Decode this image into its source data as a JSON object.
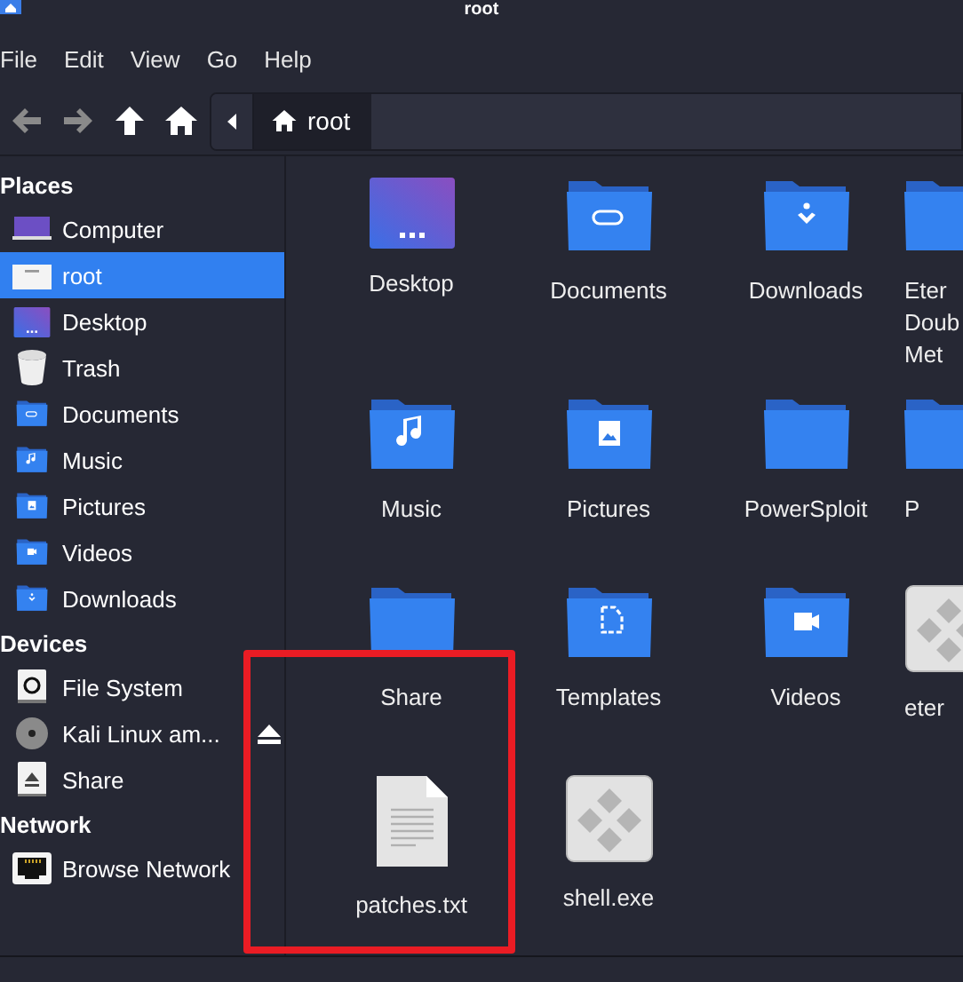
{
  "window": {
    "title": "root"
  },
  "menu": [
    "File",
    "Edit",
    "View",
    "Go",
    "Help"
  ],
  "path": {
    "segment": "root"
  },
  "sidebar": [
    {
      "heading": "Places",
      "items": [
        {
          "label": "Computer",
          "kind": "computer",
          "selected": false
        },
        {
          "label": "root",
          "kind": "home",
          "selected": true
        },
        {
          "label": "Desktop",
          "kind": "desktop",
          "selected": false
        },
        {
          "label": "Trash",
          "kind": "trash",
          "selected": false
        },
        {
          "label": "Documents",
          "kind": "documents",
          "selected": false
        },
        {
          "label": "Music",
          "kind": "music",
          "selected": false
        },
        {
          "label": "Pictures",
          "kind": "pictures",
          "selected": false
        },
        {
          "label": "Videos",
          "kind": "videos",
          "selected": false
        },
        {
          "label": "Downloads",
          "kind": "downloads",
          "selected": false
        }
      ]
    },
    {
      "heading": "Devices",
      "items": [
        {
          "label": "File System",
          "kind": "drive",
          "selected": false
        },
        {
          "label": "Kali Linux am...",
          "kind": "disc",
          "selected": false,
          "ejectable": true
        },
        {
          "label": "Share",
          "kind": "share",
          "selected": false
        }
      ]
    },
    {
      "heading": "Network",
      "items": [
        {
          "label": "Browse Network",
          "kind": "network",
          "selected": false
        }
      ]
    }
  ],
  "files": [
    {
      "lines": [
        "Desktop"
      ],
      "kind": "desktop"
    },
    {
      "lines": [
        "Documents"
      ],
      "kind": "documents"
    },
    {
      "lines": [
        "Downloads"
      ],
      "kind": "downloads"
    },
    {
      "lines": [
        "Eter",
        "Doub",
        "Met"
      ],
      "kind": "folder"
    },
    {
      "lines": [
        "Music"
      ],
      "kind": "music"
    },
    {
      "lines": [
        "Pictures"
      ],
      "kind": "pictures"
    },
    {
      "lines": [
        "PowerSploit"
      ],
      "kind": "folder"
    },
    {
      "lines": [
        "P"
      ],
      "kind": "folder"
    },
    {
      "lines": [
        "Share"
      ],
      "kind": "folder"
    },
    {
      "lines": [
        "Templates"
      ],
      "kind": "templates"
    },
    {
      "lines": [
        "Videos"
      ],
      "kind": "videos"
    },
    {
      "lines": [
        "eter"
      ],
      "kind": "exe"
    },
    {
      "lines": [
        "patches.txt"
      ],
      "kind": "text"
    },
    {
      "lines": [
        "shell.exe"
      ],
      "kind": "exe"
    }
  ]
}
